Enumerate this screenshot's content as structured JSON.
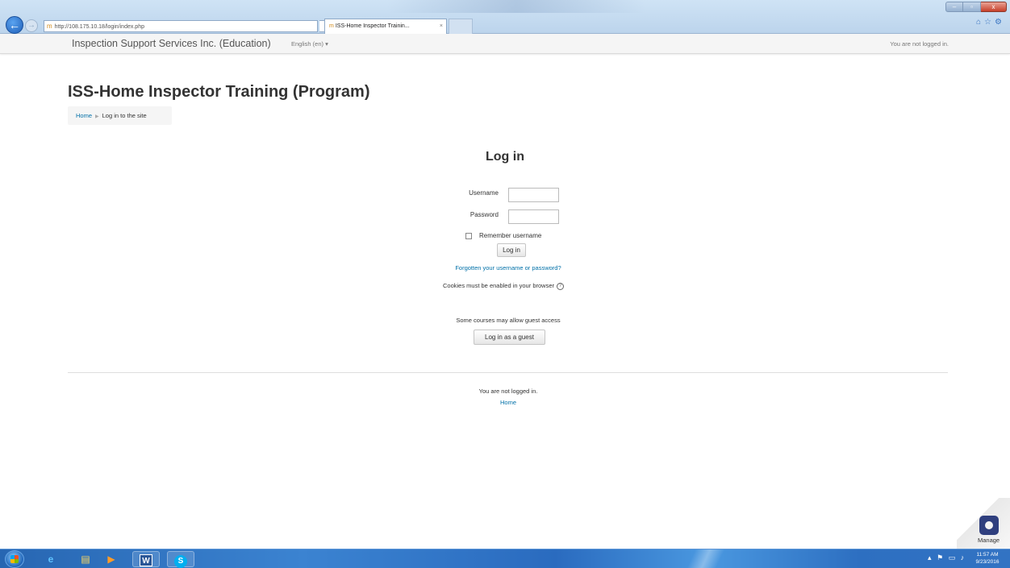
{
  "browser": {
    "address": "http://108.175.10.18/login/index.php",
    "address_tools": "⌕ ▾ ↻",
    "tab_title": "ISS-Home Inspector Trainin...",
    "tab_close": "×",
    "favicon": "m",
    "back_glyph": "←",
    "forward_glyph": "→",
    "win_min": "–",
    "win_max": "▫",
    "win_close": "x",
    "toolbar_icons": "⌂☆⚙"
  },
  "navbar": {
    "brand": "Inspection Support Services Inc. (Education)",
    "language": "English (en) ▾",
    "login_status": "You are not logged in."
  },
  "header": {
    "title": "ISS-Home Inspector Training (Program)",
    "breadcrumb": {
      "home": "Home",
      "separator": "▶",
      "current": "Log in to the site"
    }
  },
  "login": {
    "title": "Log in",
    "username_label": "Username",
    "username_value": "",
    "password_label": "Password",
    "password_value": "",
    "remember_label": "Remember username",
    "remember_checked": false,
    "submit_label": "Log in",
    "forgot_link": "Forgotten your username or password?",
    "cookies_notice": "Cookies must be enabled in your browser",
    "help_glyph": "?",
    "guest_notice": "Some courses may allow guest access",
    "guest_button": "Log in as a guest"
  },
  "footer": {
    "login_status": "You are not logged in.",
    "home_link": "Home"
  },
  "manage": {
    "label": "Manage"
  },
  "taskbar": {
    "ie_glyph": "e",
    "folder_glyph": "▤",
    "media_glyph": "▶",
    "word_glyph": "W",
    "skype_glyph": "S",
    "tray_icons": "▴ ⚑ ▭ ♪",
    "time": "11:57 AM",
    "date": "9/23/2016"
  },
  "colors": {
    "link": "#0070a8",
    "text": "#333333",
    "navbar_bg": "#f5f5f5",
    "taskbar": "#2a6bbf"
  }
}
